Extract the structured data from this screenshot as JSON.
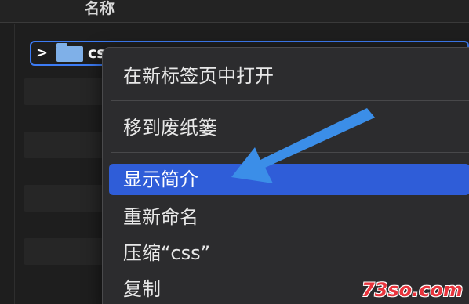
{
  "finder": {
    "column_header": "名称",
    "selected_item": {
      "name": "css"
    }
  },
  "context_menu": {
    "items": [
      {
        "label": "在新标签页中打开"
      },
      {
        "label": "移到废纸篓"
      },
      {
        "label": "显示简介"
      },
      {
        "label": "重新命名"
      },
      {
        "label": "压缩“css”"
      },
      {
        "label": "复制"
      }
    ]
  },
  "highlight_color": "#2f5dd8",
  "arrow_color": "#3b8ee8",
  "watermark": "73so.com"
}
